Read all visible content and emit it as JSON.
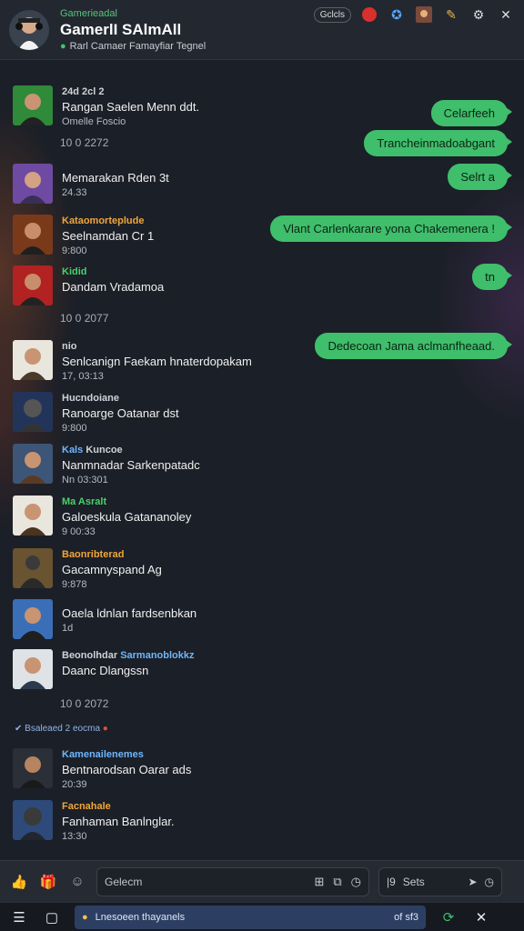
{
  "header": {
    "subtitle": "Gamerieadal",
    "title": "GamerlI SAlmAll",
    "status": "Rarl Camaer Famayfiar Tegnel",
    "actions": {
      "tag": "Gclcls"
    }
  },
  "messages": [
    {
      "name": "24d 2cl 2",
      "name_color": "#cfd2d8",
      "text": "Rangan Saelen Menn ddt.",
      "time": "Omelle Foscio"
    },
    {
      "name": "",
      "name_color": "#cfd2d8",
      "text": "Memarakan Rden 3t",
      "time": "24.33"
    },
    {
      "name": "Kataomorteplude",
      "name_color": "#f0a63a",
      "text": "Seelnamdan Cr 1",
      "time": "9:800"
    },
    {
      "name": "Kidid",
      "name_color": "#4ad06a",
      "text": "Dandam Vradamoa",
      "time": ""
    },
    {
      "name": "nio",
      "name_color": "#cfd2d8",
      "text": "Senlcanign Faekam hnaterdopakam",
      "time": "17, 03:13"
    },
    {
      "name": "Hucndoiane",
      "name_color": "#cfd2d8",
      "text": "Ranoarge Oatanar dst",
      "time": "9:800"
    },
    {
      "name": "Kals",
      "name_color": "#6fb6ff",
      "name2": "Kuncoe",
      "text": "Nanmnadar Sarkenpatadc",
      "time": "Nn 03:301"
    },
    {
      "name": "Ma Asralt",
      "name_color": "#4ad06a",
      "text": "Galoeskula Gatananoley",
      "time": "9 00:33"
    },
    {
      "name": "Baonribterad",
      "name_color": "#f0a63a",
      "text": "Gacamnyspand Ag",
      "time": "9:878"
    },
    {
      "name": "",
      "name_color": "#cfd2d8",
      "text": "Oaela ldnlan fardsenbkan",
      "time": "1d"
    },
    {
      "name": "Beonolhdar",
      "name_color": "#cfd2d8",
      "name2": "Sarmanoblokkz",
      "text": "Daanc Dlangssn",
      "time": ""
    },
    {
      "name": "Kamenailenemes",
      "name_color": "#6fb6ff",
      "text": "Bentnarodsan Oarar ads",
      "time": "20:39"
    },
    {
      "name": "Facnahale",
      "name_color": "#f0a63a",
      "text": "Fanhaman Banlnglar.",
      "time": "13:30"
    }
  ],
  "dividers": [
    "10 0 2272",
    "10 0 2077",
    "10 0 2072"
  ],
  "system_note": "Bsaleaed 2 eocma",
  "bubbles": [
    "Celarfeeh",
    "Trancheinmadoabgant",
    "Selrt a",
    "Vlant Carlenkarare yona Chakemenera !",
    "tn",
    "Dedecoan Jama aclmanfheaad."
  ],
  "composer": {
    "input_placeholder": "Gelecm",
    "send_placeholder": "Sets"
  },
  "bottom_bar": {
    "input_text": "Lnesoeen thayanels",
    "counter": "of sf3"
  },
  "colors": {
    "accent": "#3fbe6b",
    "background": "#1b1f27"
  }
}
